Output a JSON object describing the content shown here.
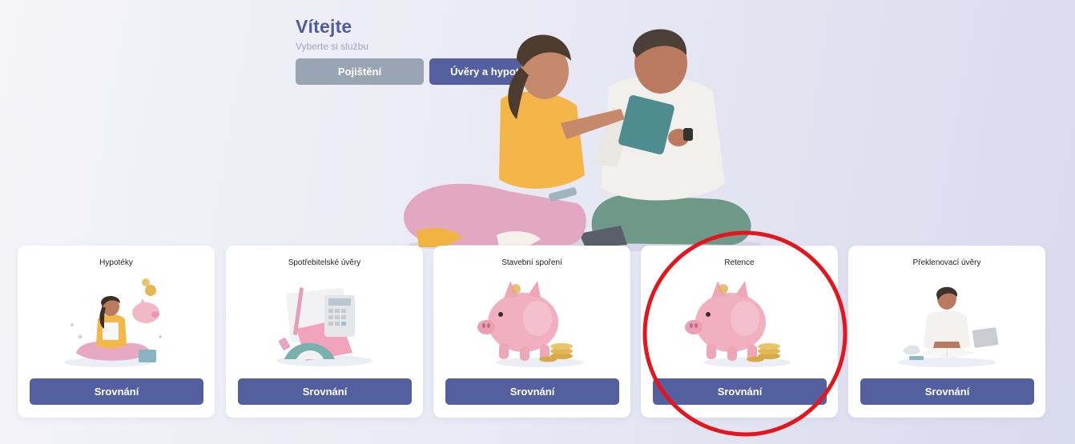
{
  "header": {
    "title": "Vítejte",
    "subtitle": "Vyberte si službu"
  },
  "tabs": [
    {
      "label": "Pojištění",
      "active": false
    },
    {
      "label": "Úvěry a hypotéky",
      "active": true
    }
  ],
  "cards": [
    {
      "title": "Hypotéky",
      "button": "Srovnání",
      "icon": "woman-with-piggy-bank-illustration"
    },
    {
      "title": "Spotřebitelské úvěry",
      "button": "Srovnání",
      "icon": "calculator-and-stationery-illustration"
    },
    {
      "title": "Stavební spoření",
      "button": "Srovnání",
      "icon": "piggy-bank-with-coins-illustration"
    },
    {
      "title": "Retence",
      "button": "Srovnání",
      "icon": "piggy-bank-with-coins-illustration"
    },
    {
      "title": "Překlenovací úvěry",
      "button": "Srovnání",
      "icon": "man-studying-illustration"
    }
  ],
  "colors": {
    "accent": "#545fa0",
    "tab_inactive": "#9aa5b4",
    "title": "#535c9a",
    "highlight_ring": "#e3161e"
  }
}
